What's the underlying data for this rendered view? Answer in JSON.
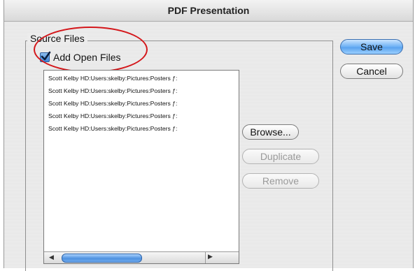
{
  "window": {
    "title": "PDF Presentation"
  },
  "source_files": {
    "legend": "Source Files",
    "add_open_files": {
      "label": "Add Open Files",
      "checked": true
    },
    "files": [
      "Scott Kelby HD:Users:skelby:Pictures:Posters ƒ:",
      "Scott Kelby HD:Users:skelby:Pictures:Posters ƒ:",
      "Scott Kelby HD:Users:skelby:Pictures:Posters ƒ:",
      "Scott Kelby HD:Users:skelby:Pictures:Posters ƒ:",
      "Scott Kelby HD:Users:skelby:Pictures:Posters ƒ:"
    ],
    "buttons": {
      "browse": "Browse...",
      "duplicate": "Duplicate",
      "remove": "Remove"
    }
  },
  "dialog_buttons": {
    "save": "Save",
    "cancel": "Cancel"
  },
  "colors": {
    "highlight_oval": "#d4171b",
    "aqua_accent": "#5aa2ee"
  }
}
